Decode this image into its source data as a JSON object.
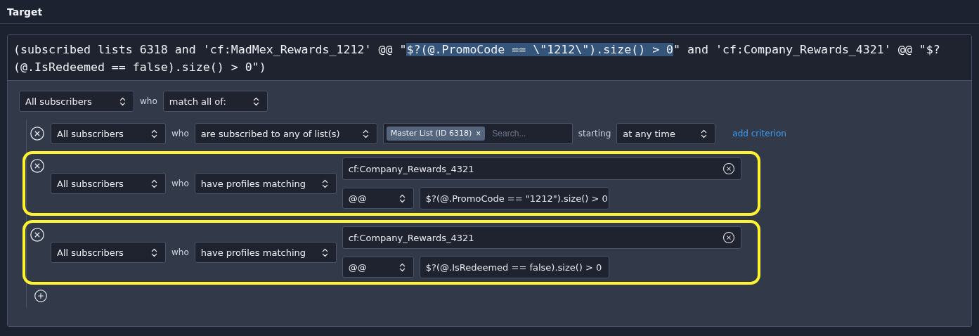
{
  "section": {
    "title": "Target"
  },
  "query": [
    {
      "text": "(subscribed lists 6318 and 'cf:MadMex_Rewards_1212' @@ \"",
      "selected": false
    },
    {
      "text": "$?(@.PromoCode == \\\"1212\\\").size() > 0",
      "selected": true
    },
    {
      "text": "\" and 'cf:Company_Rewards_4321' @@ \"$?(@.IsRedeemed == false).size() > 0\")",
      "selected": false
    }
  ],
  "root": {
    "audience": "All subscribers",
    "who": "who",
    "match": "match all of:"
  },
  "criteria": [
    {
      "kind": "list",
      "highlighted": false,
      "audience": "All subscribers",
      "who": "who",
      "condition": "are subscribed to any of list(s)",
      "tags": [
        "Master List (ID 6318)"
      ],
      "tag_remove": "×",
      "search_placeholder": "Search...",
      "starting_label": "starting",
      "starting": "at any time",
      "add": "add criterion"
    },
    {
      "kind": "profile",
      "highlighted": true,
      "audience": "All subscribers",
      "who": "who",
      "condition": "have profiles matching",
      "field": "cf:Company_Rewards_4321",
      "operator": "@@",
      "value": "$?(@.PromoCode == \"1212\").size() > 0"
    },
    {
      "kind": "profile",
      "highlighted": true,
      "audience": "All subscribers",
      "who": "who",
      "condition": "have profiles matching",
      "field": "cf:Company_Rewards_4321",
      "operator": "@@",
      "value": "$?(@.IsRedeemed == false).size() > 0"
    }
  ]
}
